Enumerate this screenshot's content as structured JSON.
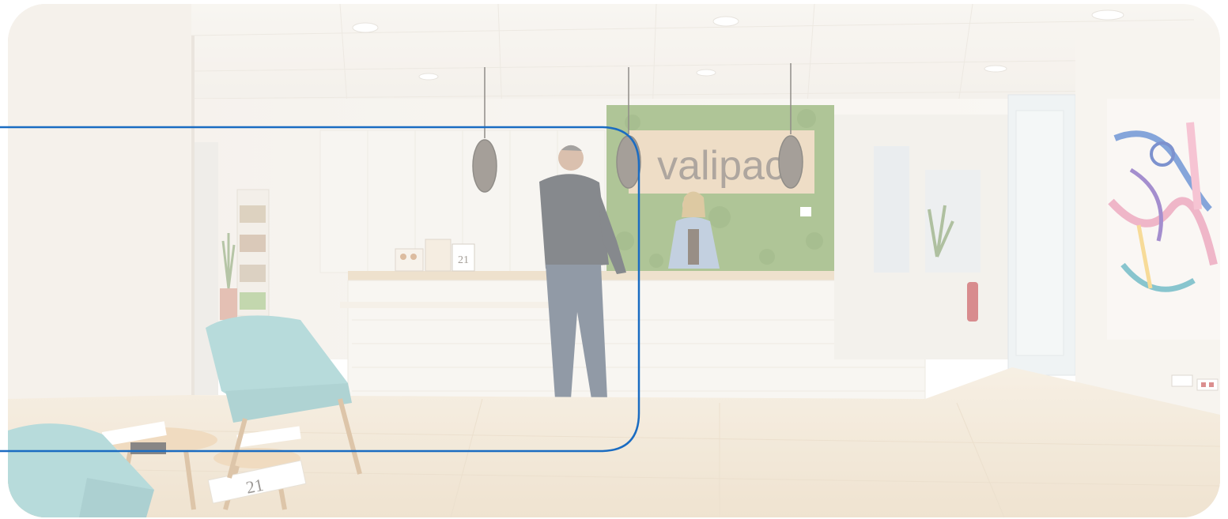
{
  "scene": {
    "description_sign": "valipac",
    "sign_text": "valipac",
    "brochure_number": "21",
    "colors": {
      "accent_outline": "#1a6cc2",
      "moss_wall": "#6f9a4a",
      "chair_teal": "#88c7c9",
      "floor_oak": "#e8d7bd",
      "desk_white": "#f1ece4"
    }
  }
}
